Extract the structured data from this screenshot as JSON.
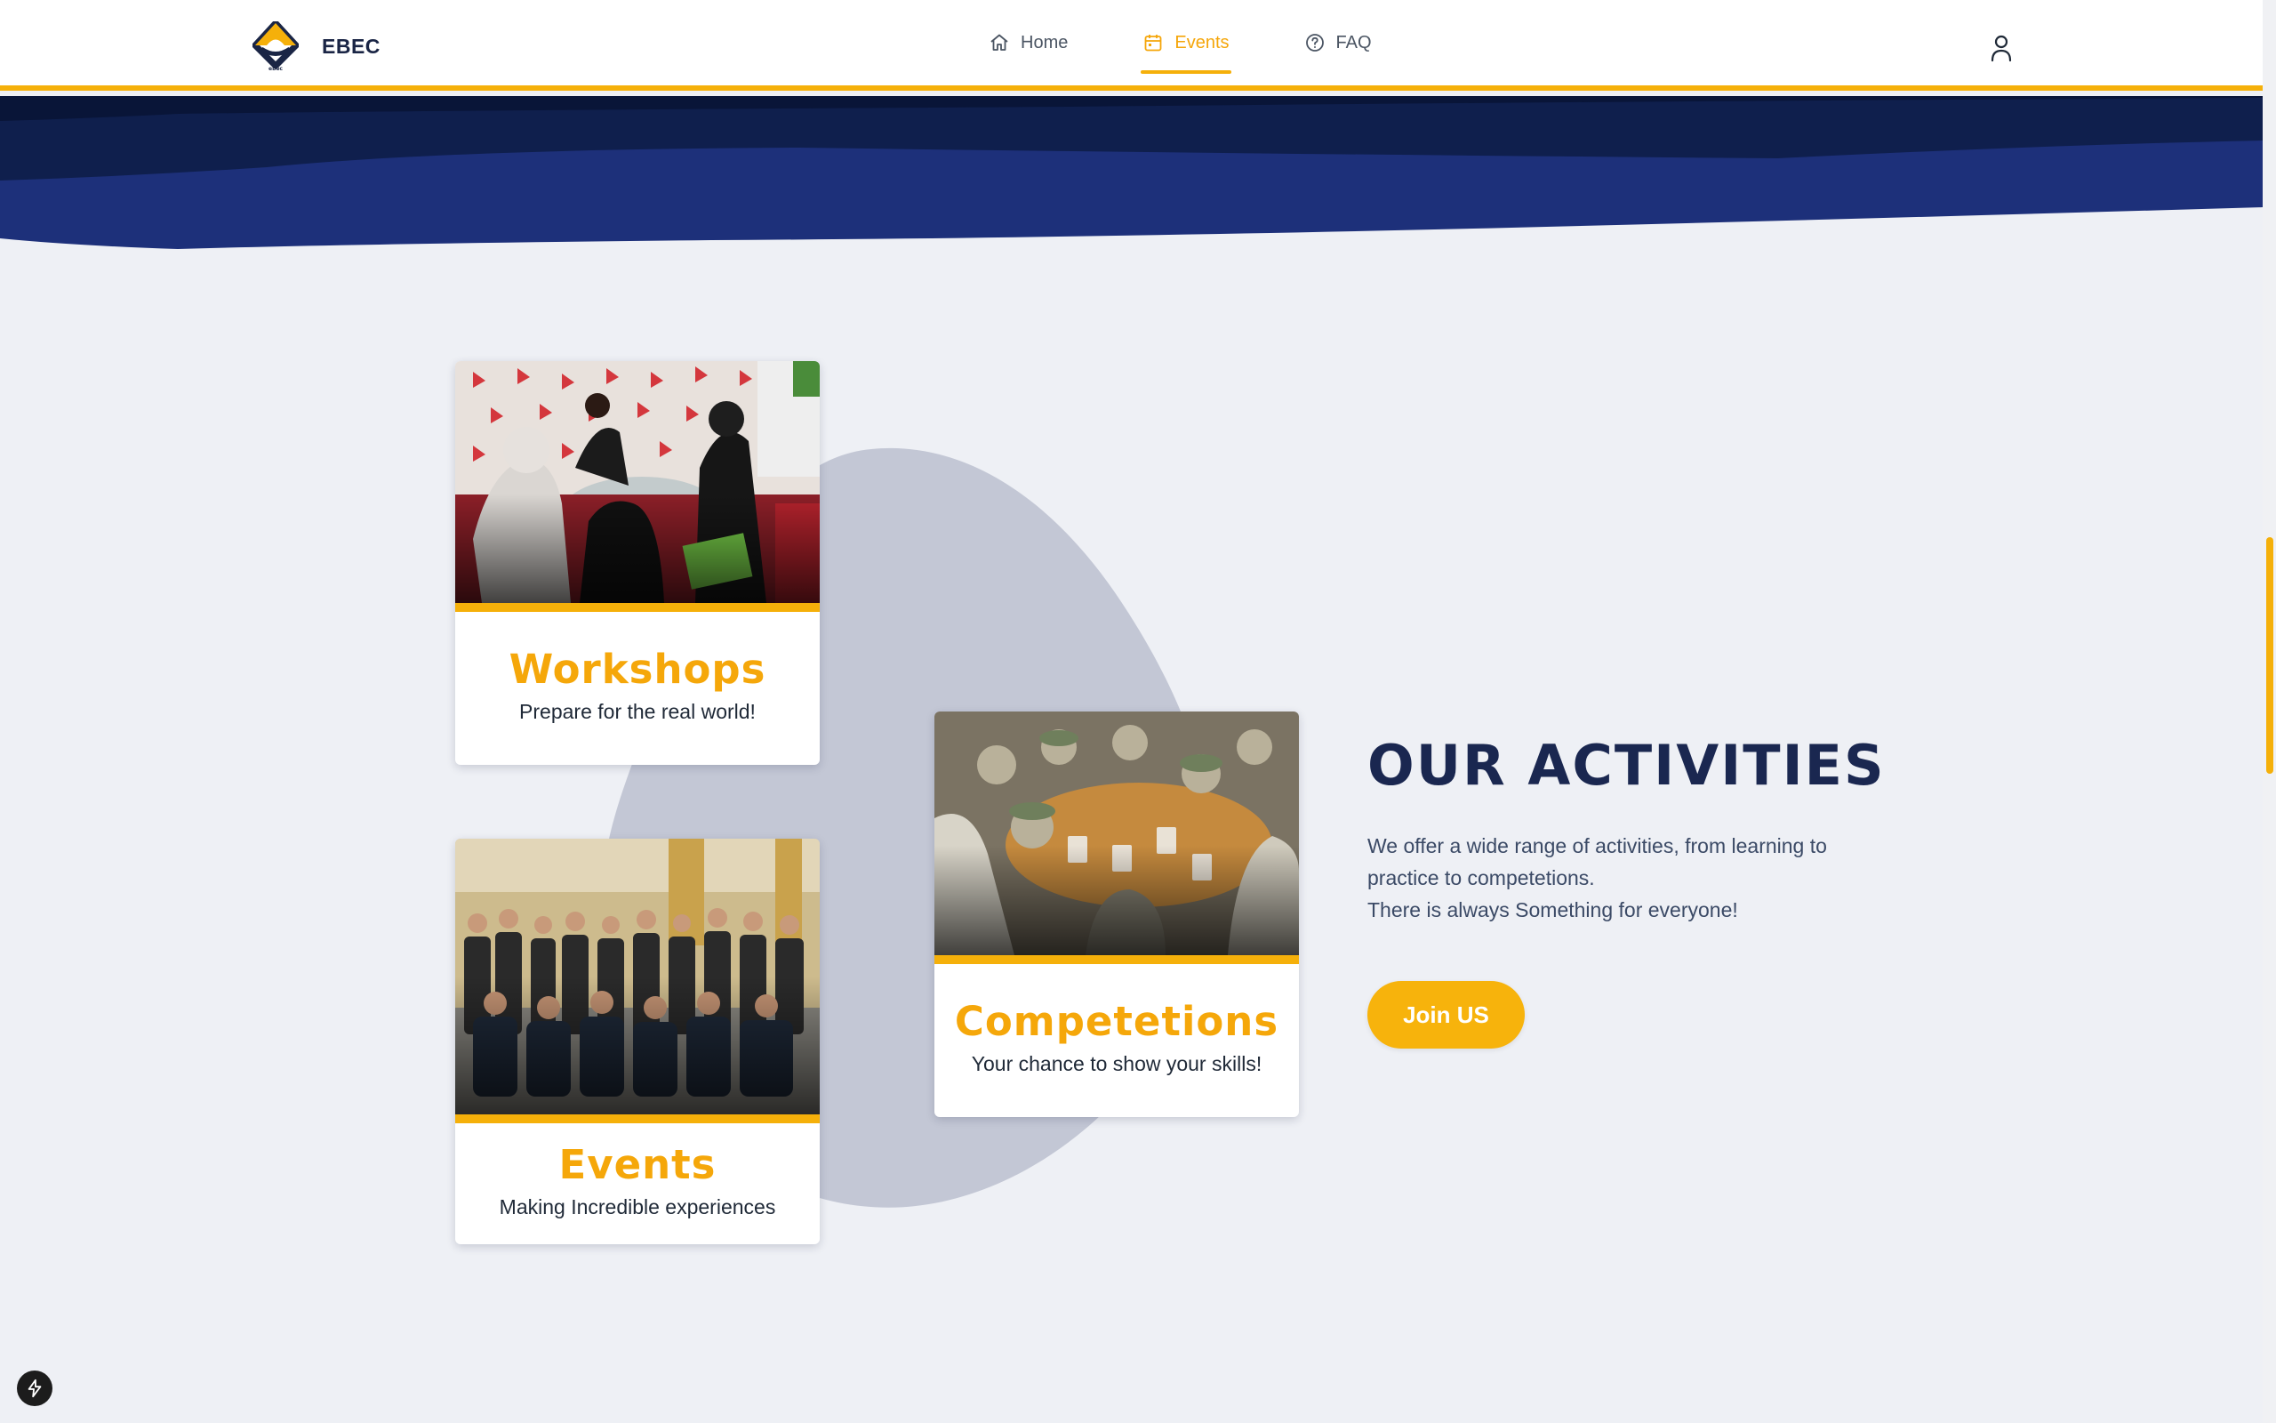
{
  "brand": {
    "name": "EBEC",
    "logo_icon": "ebec-logo",
    "logo_caption": "ebec"
  },
  "nav": {
    "items": [
      {
        "label": "Home",
        "icon": "home-icon",
        "active": false
      },
      {
        "label": "Events",
        "icon": "calendar-icon",
        "active": true
      },
      {
        "label": "FAQ",
        "icon": "help-circle-icon",
        "active": false
      }
    ],
    "user_icon": "user-icon"
  },
  "cards": {
    "workshops": {
      "title": "Workshops",
      "subtitle": "Prepare for the real world!"
    },
    "competitions": {
      "title": "Competetions",
      "subtitle": "Your chance to show your skills!"
    },
    "events": {
      "title": "Events",
      "subtitle": "Making Incredible experiences"
    }
  },
  "activities": {
    "heading": "OUR ACTIVITIES",
    "line1": "We offer a wide range of activities, from learning to",
    "line2": "practice to competetions.",
    "line3": "There is always Something for everyone!",
    "cta_label": "Join US"
  },
  "colors": {
    "accent": "#f5b00a",
    "navy_dark": "#0e1f4a",
    "navy": "#1d307a",
    "background": "#eef0f5",
    "blob": "#c3c7d5"
  },
  "floating_button_icon": "bolt-icon"
}
